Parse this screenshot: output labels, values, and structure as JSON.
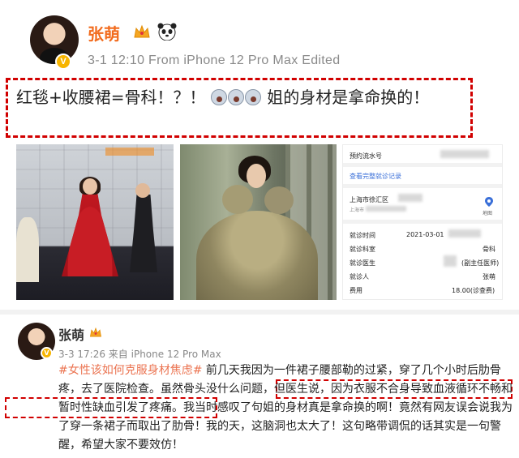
{
  "post1": {
    "author": "张萌",
    "meta": "3-1 12:10  From iPhone 12 Pro Max  Edited",
    "text": "红毯+收腰裙=骨科！？！",
    "text_after": "姐的身材是拿命换的！",
    "emoji_count": 3
  },
  "receipt": {
    "pre_no_label": "预约流水号",
    "view_details": "查看完整就诊记录",
    "hospital": "上海市徐汇区",
    "hospital_sub": "上海市",
    "map_label": "地图",
    "rows": [
      {
        "label": "就诊时间",
        "value": "2021-03-01"
      },
      {
        "label": "就诊科室",
        "value": "骨科"
      },
      {
        "label": "就诊医生",
        "value": "(副主任医师)"
      },
      {
        "label": "就诊人",
        "value": "张萌"
      },
      {
        "label": "费用",
        "value": "18.00(诊查费)"
      }
    ]
  },
  "post2": {
    "author": "张萌",
    "meta": "3-3 17:26  来自 iPhone 12 Pro Max",
    "topic": "#女性该如何克服身材焦虑#",
    "body_1": " 前几天我因为一件裙子腰部勒的过紧，穿了几个小时后肋骨疼，去了医院检查。虽然骨头没什么问题，",
    "body_highlight": "但医生说，因为衣服不合身导致血液循环不畅和暂时性缺血引发了疼痛。",
    "body_2": "我当时感叹了句姐的身材真是拿命换的啊！竟然有网友误会说我为了穿一条裙子而取出了肋骨！我的天，这脑洞也太大了！这句略带调侃的话其实是一句警醒，希望大家不要效仿！"
  }
}
